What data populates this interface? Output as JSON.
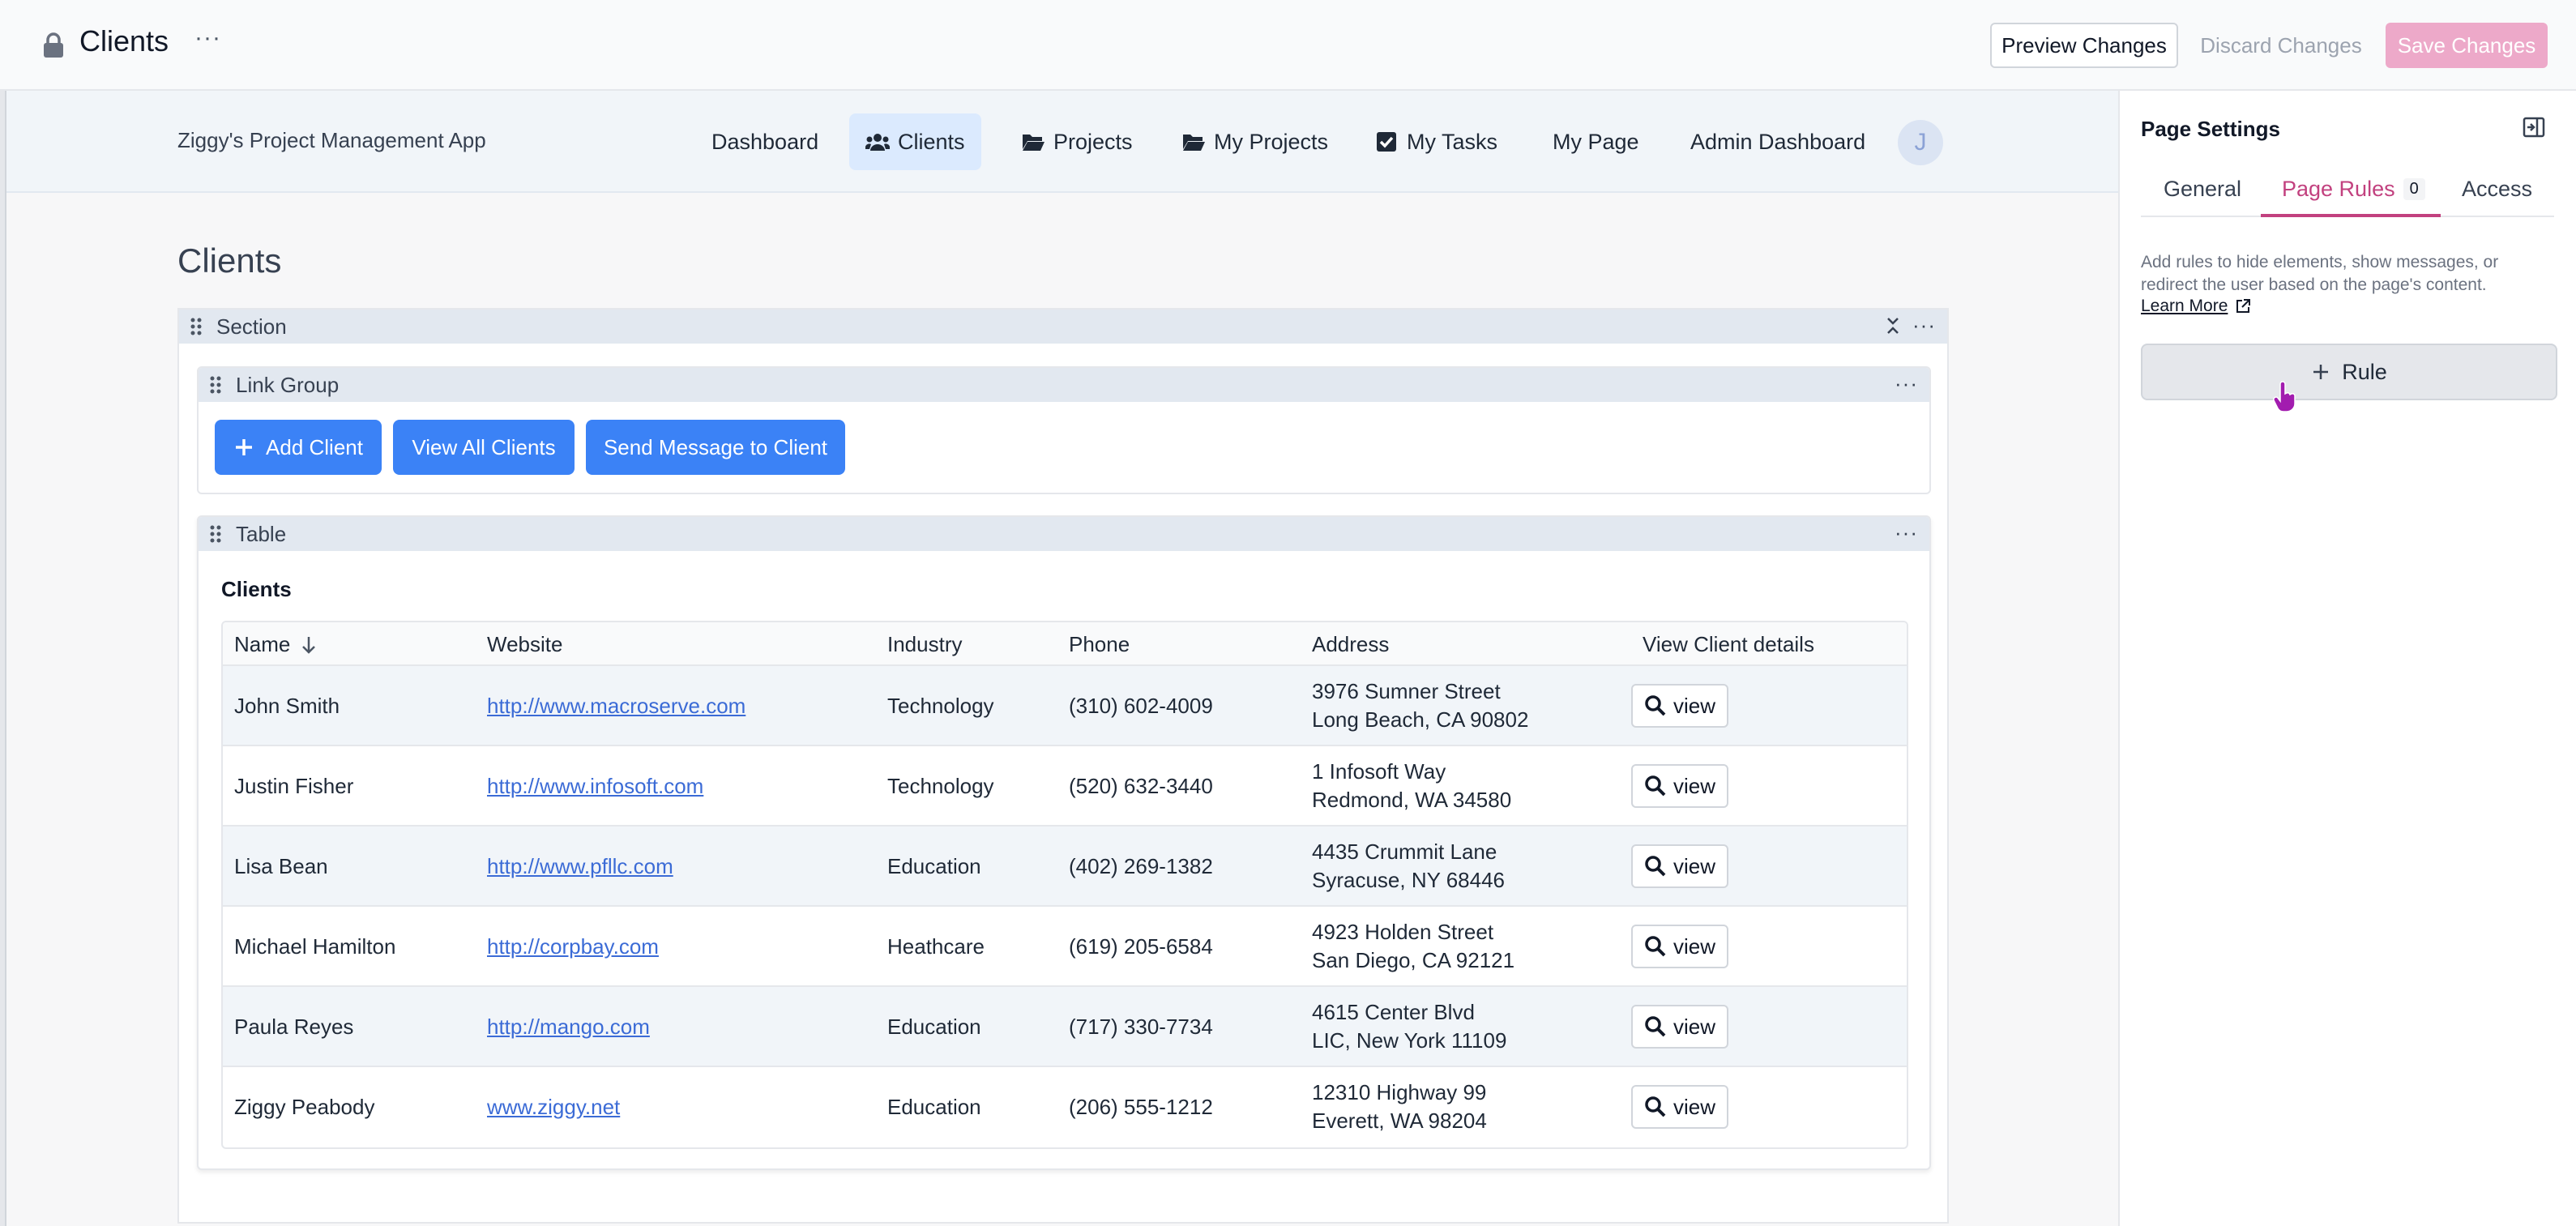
{
  "topbar": {
    "title": "Clients",
    "more_icon": "ellipsis-icon",
    "preview_label": "Preview Changes",
    "discard_label": "Discard Changes",
    "save_label": "Save Changes"
  },
  "app": {
    "name": "Ziggy's Project Management App",
    "nav": [
      {
        "label": "Dashboard",
        "icon": null
      },
      {
        "label": "Clients",
        "icon": "users-icon"
      },
      {
        "label": "Projects",
        "icon": "folder-open-icon"
      },
      {
        "label": "My Projects",
        "icon": "folder-open-icon"
      },
      {
        "label": "My Tasks",
        "icon": "check-square-icon"
      },
      {
        "label": "My Page",
        "icon": null
      },
      {
        "label": "Admin Dashboard",
        "icon": null
      }
    ],
    "active_nav": "Clients",
    "avatar_initial": "J"
  },
  "page": {
    "heading": "Clients",
    "section_label": "Section",
    "link_group_label": "Link Group",
    "links": [
      "Add Client",
      "View All Clients",
      "Send Message to Client"
    ],
    "table_label": "Table",
    "table": {
      "title": "Clients",
      "columns": [
        "Name",
        "Website",
        "Industry",
        "Phone",
        "Address",
        "View Client details"
      ],
      "sort_column": "Name",
      "view_label": "view",
      "rows": [
        {
          "name": "John Smith",
          "website": "http://www.macroserve.com",
          "industry": "Technology",
          "phone": "(310) 602-4009",
          "address1": "3976 Sumner Street",
          "address2": "Long Beach, CA 90802"
        },
        {
          "name": "Justin Fisher",
          "website": "http://www.infosoft.com",
          "industry": "Technology",
          "phone": "(520) 632-3440",
          "address1": "1 Infosoft Way",
          "address2": "Redmond, WA 34580"
        },
        {
          "name": "Lisa Bean",
          "website": "http://www.pfllc.com",
          "industry": "Education",
          "phone": "(402) 269-1382",
          "address1": "4435 Crummit Lane",
          "address2": "Syracuse, NY 68446"
        },
        {
          "name": "Michael Hamilton",
          "website": "http://corpbay.com",
          "industry": "Heathcare",
          "phone": "(619) 205-6584",
          "address1": "4923 Holden Street",
          "address2": "San Diego, CA 92121"
        },
        {
          "name": "Paula Reyes",
          "website": "http://mango.com",
          "industry": "Education",
          "phone": "(717) 330-7734",
          "address1": "4615 Center Blvd",
          "address2": "LIC, New York 11109"
        },
        {
          "name": "Ziggy Peabody",
          "website": "www.ziggy.net",
          "industry": "Education",
          "phone": "(206) 555-1212",
          "address1": "12310 Highway 99",
          "address2": "Everett, WA 98204"
        }
      ]
    }
  },
  "panel": {
    "title": "Page Settings",
    "tabs": [
      {
        "label": "General"
      },
      {
        "label": "Page Rules",
        "count": "0"
      },
      {
        "label": "Access"
      }
    ],
    "active_tab": "Page Rules",
    "description": "Add rules to hide elements, show messages, or redirect the user based on the page's content.",
    "learn_more": "Learn More",
    "rule_button": "Rule"
  },
  "colors": {
    "accent": "#3b82f6",
    "active_tab": "#c2417f",
    "save_button": "#eda9c9",
    "nav_active_bg": "#dbeafe"
  }
}
